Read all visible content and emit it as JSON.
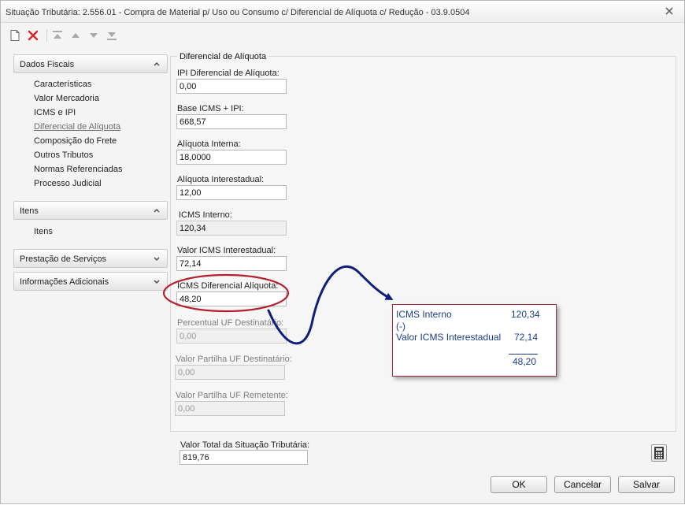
{
  "window": {
    "title": "Situação Tributária: 2.556.01 - Compra de Material p/ Uso ou Consumo c/ Diferencial de Alíquota c/ Redução - 03.9.0504"
  },
  "toolbar": {
    "icons": [
      "new-document-icon",
      "delete-icon",
      "move-first-icon",
      "move-up-icon",
      "move-down-icon",
      "move-last-icon"
    ]
  },
  "sidebar": {
    "groups": [
      {
        "title": "Dados Fiscais",
        "expanded": true,
        "items": [
          {
            "label": "Características"
          },
          {
            "label": "Valor Mercadoria"
          },
          {
            "label": "ICMS e IPI"
          },
          {
            "label": "Diferencial de Alíquota",
            "active": true
          },
          {
            "label": "Composição do Frete"
          },
          {
            "label": "Outros Tributos"
          },
          {
            "label": "Normas Referenciadas"
          },
          {
            "label": "Processo Judicial"
          }
        ]
      },
      {
        "title": "Itens",
        "expanded": true,
        "items": [
          {
            "label": "Itens"
          }
        ]
      },
      {
        "title": "Prestação de Serviços",
        "expanded": false,
        "items": []
      },
      {
        "title": "Informações Adicionais",
        "expanded": false,
        "items": []
      }
    ]
  },
  "section": {
    "title": "Diferencial de Alíquota",
    "fields": [
      {
        "label": "IPI Diferencial de Alíquota:",
        "value": "0,00",
        "state": "editable"
      },
      {
        "label": "Base ICMS + IPI:",
        "value": "668,57",
        "state": "editable"
      },
      {
        "label": "Alíquota Interna:",
        "value": "18,0000",
        "state": "editable"
      },
      {
        "label": "Alíquota Interestadual:",
        "value": "12,00",
        "state": "editable"
      },
      {
        "label": "ICMS Interno:",
        "value": "120,34",
        "state": "readonly"
      },
      {
        "label": "Valor ICMS Interestadual:",
        "value": "72,14",
        "state": "editable"
      },
      {
        "label": "ICMS Diferencial Alíquota:",
        "value": "48,20",
        "state": "editable"
      },
      {
        "label": "Percentual UF Destinatário:",
        "value": "0,00",
        "state": "disabled"
      },
      {
        "label": "Valor Partilha UF Destinatário:",
        "value": "0,00",
        "state": "disabled"
      },
      {
        "label": "Valor Partilha UF Remetente:",
        "value": "0,00",
        "state": "disabled"
      }
    ]
  },
  "callout": {
    "line1_label": "ICMS Interno",
    "line1_value": "120,34",
    "operator": "(-)",
    "line2_label": "Valor ICMS Interestadual",
    "line2_value": "72,14",
    "result": "48,20"
  },
  "footer": {
    "total_label": "Valor Total da Situação Tributária:",
    "total_value": "819,76",
    "ok_label": "OK",
    "cancel_label": "Cancelar",
    "save_label": "Salvar"
  },
  "colors": {
    "annotation_ellipse": "#b32030",
    "annotation_arrow": "#0f1f7a",
    "callout_text": "#1c3c8c"
  }
}
